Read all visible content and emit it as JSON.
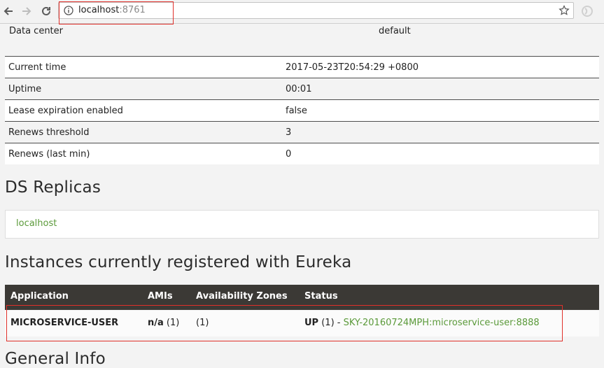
{
  "browser": {
    "url_host": "localhost",
    "url_port": ":8761",
    "back_icon": "arrow-left-icon",
    "forward_icon": "arrow-right-icon",
    "reload_icon": "reload-icon",
    "info_icon": "info-icon",
    "bookmark_icon": "star-icon",
    "extension_icon": "extension-icon"
  },
  "environment": {
    "label": "Data center",
    "value": "default"
  },
  "status_table": [
    {
      "key": "Current time",
      "value": "2017-05-23T20:54:29 +0800"
    },
    {
      "key": "Uptime",
      "value": "00:01"
    },
    {
      "key": "Lease expiration enabled",
      "value": "false"
    },
    {
      "key": "Renews threshold",
      "value": "3"
    },
    {
      "key": "Renews (last min)",
      "value": "0"
    }
  ],
  "ds_replicas": {
    "heading": "DS Replicas",
    "items": [
      "localhost"
    ]
  },
  "instances": {
    "heading": "Instances currently registered with Eureka",
    "columns": [
      "Application",
      "AMIs",
      "Availability Zones",
      "Status"
    ],
    "rows": [
      {
        "application": "MICROSERVICE-USER",
        "amis_value": "n/a",
        "amis_count": " (1)",
        "zones": "(1)",
        "status_text": "UP (1) - ",
        "status_link": "SKY-20160724MPH:microservice-user:8888"
      }
    ]
  },
  "general_info": {
    "heading": "General Info"
  },
  "colors": {
    "link": "#5b9a3a",
    "table_header_bg": "#3b3935",
    "highlight": "#e0302a"
  }
}
